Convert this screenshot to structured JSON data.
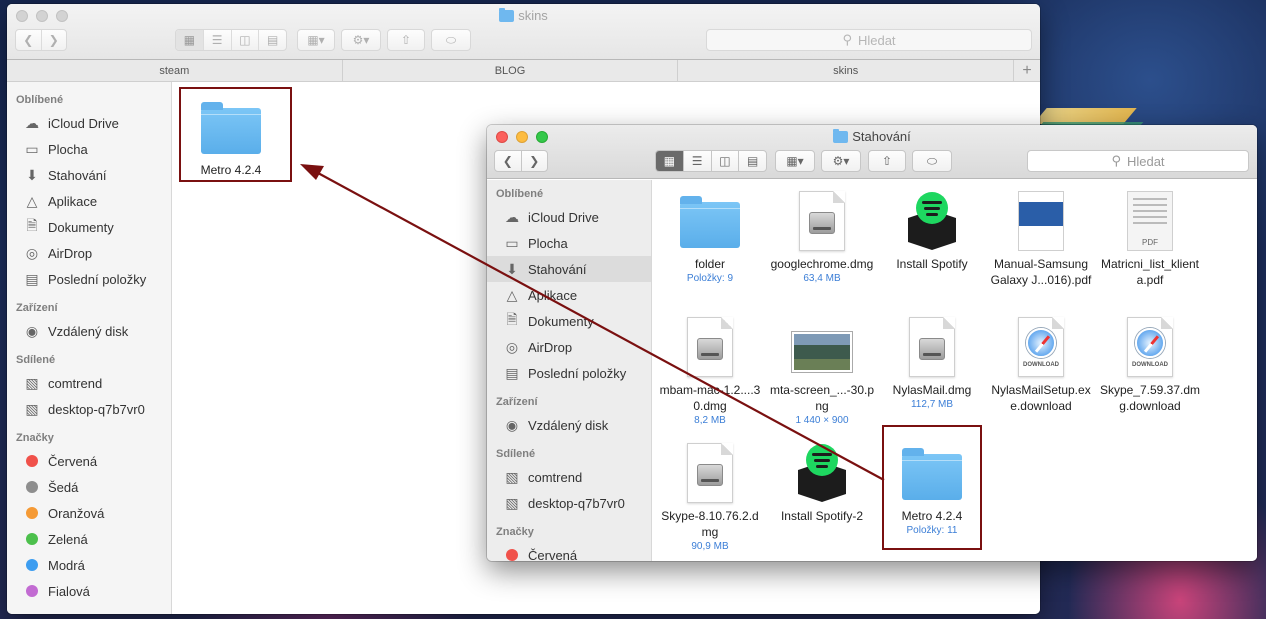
{
  "colors": {
    "accent_blue": "#3b7ed6",
    "highlight_red": "#7a1010",
    "tag_red": "#f0514a",
    "tag_gray": "#8e8e8e",
    "tag_orange": "#f59a35",
    "tag_green": "#4cc04c",
    "tag_blue": "#3d9df0",
    "tag_purple": "#c26bd2"
  },
  "window_back": {
    "title": "skins",
    "search_placeholder": "Hledat",
    "tabs": [
      "steam",
      "BLOG",
      "skins"
    ],
    "sidebar": {
      "favorites_header": "Oblíbené",
      "favorites": [
        {
          "label": "iCloud Drive",
          "icon": "cloud-icon"
        },
        {
          "label": "Plocha",
          "icon": "desktop-icon"
        },
        {
          "label": "Stahování",
          "icon": "download-icon"
        },
        {
          "label": "Aplikace",
          "icon": "applications-icon"
        },
        {
          "label": "Dokumenty",
          "icon": "documents-icon"
        },
        {
          "label": "AirDrop",
          "icon": "airdrop-icon"
        },
        {
          "label": "Poslední položky",
          "icon": "recents-icon"
        }
      ],
      "devices_header": "Zařízení",
      "devices": [
        {
          "label": "Vzdálený disk",
          "icon": "disc-icon"
        }
      ],
      "shared_header": "Sdílené",
      "shared": [
        {
          "label": "comtrend",
          "icon": "computer-icon"
        },
        {
          "label": "desktop-q7b7vr0",
          "icon": "computer-icon"
        }
      ],
      "tags_header": "Značky",
      "tags": [
        {
          "label": "Červená",
          "color": "#f0514a"
        },
        {
          "label": "Šedá",
          "color": "#8e8e8e"
        },
        {
          "label": "Oranžová",
          "color": "#f59a35"
        },
        {
          "label": "Zelená",
          "color": "#4cc04c"
        },
        {
          "label": "Modrá",
          "color": "#3d9df0"
        },
        {
          "label": "Fialová",
          "color": "#c26bd2"
        }
      ]
    },
    "items": [
      {
        "name": "Metro 4.2.4",
        "type": "folder"
      }
    ]
  },
  "window_front": {
    "title": "Stahování",
    "search_placeholder": "Hledat",
    "sidebar": {
      "favorites_header": "Oblíbené",
      "favorites": [
        {
          "label": "iCloud Drive",
          "icon": "cloud-icon"
        },
        {
          "label": "Plocha",
          "icon": "desktop-icon"
        },
        {
          "label": "Stahování",
          "icon": "download-icon"
        },
        {
          "label": "Aplikace",
          "icon": "applications-icon"
        },
        {
          "label": "Dokumenty",
          "icon": "documents-icon"
        },
        {
          "label": "AirDrop",
          "icon": "airdrop-icon"
        },
        {
          "label": "Poslední položky",
          "icon": "recents-icon"
        }
      ],
      "devices_header": "Zařízení",
      "devices": [
        {
          "label": "Vzdálený disk",
          "icon": "disc-icon"
        }
      ],
      "shared_header": "Sdílené",
      "shared": [
        {
          "label": "comtrend",
          "icon": "computer-icon"
        },
        {
          "label": "desktop-q7b7vr0",
          "icon": "computer-icon"
        }
      ],
      "tags_header": "Značky",
      "tags": [
        {
          "label": "Červená",
          "color": "#f0514a"
        }
      ]
    },
    "items": [
      {
        "name": "folder",
        "sub": "Položky: 9",
        "type": "folder"
      },
      {
        "name": "googlechrome.dmg",
        "sub": "63,4 MB",
        "type": "dmg"
      },
      {
        "name": "Install Spotify",
        "sub": "",
        "type": "spotify"
      },
      {
        "name": "Manual-Samsung Galaxy J...016).pdf",
        "sub": "",
        "type": "pdf-blue"
      },
      {
        "name": "Matricni_list_klienta.pdf",
        "sub": "",
        "type": "pdf"
      },
      {
        "name": "mbam-mac-1.2....30.dmg",
        "sub": "8,2 MB",
        "type": "dmg"
      },
      {
        "name": "mta-screen_...-30.png",
        "sub": "1 440 × 900",
        "type": "png"
      },
      {
        "name": "NylasMail.dmg",
        "sub": "112,7 MB",
        "type": "dmg"
      },
      {
        "name": "NylasMailSetup.exe.download",
        "sub": "",
        "type": "download"
      },
      {
        "name": "Skype_7.59.37.dmg.download",
        "sub": "",
        "type": "download"
      },
      {
        "name": "Skype-8.10.76.2.dmg",
        "sub": "90,9 MB",
        "type": "dmg"
      },
      {
        "name": "Install Spotify-2",
        "sub": "",
        "type": "spotify"
      },
      {
        "name": "Metro 4.2.4",
        "sub": "Položky: 11",
        "type": "folder"
      }
    ],
    "pdf_tag": "PDF",
    "download_tag": "DOWNLOAD"
  }
}
